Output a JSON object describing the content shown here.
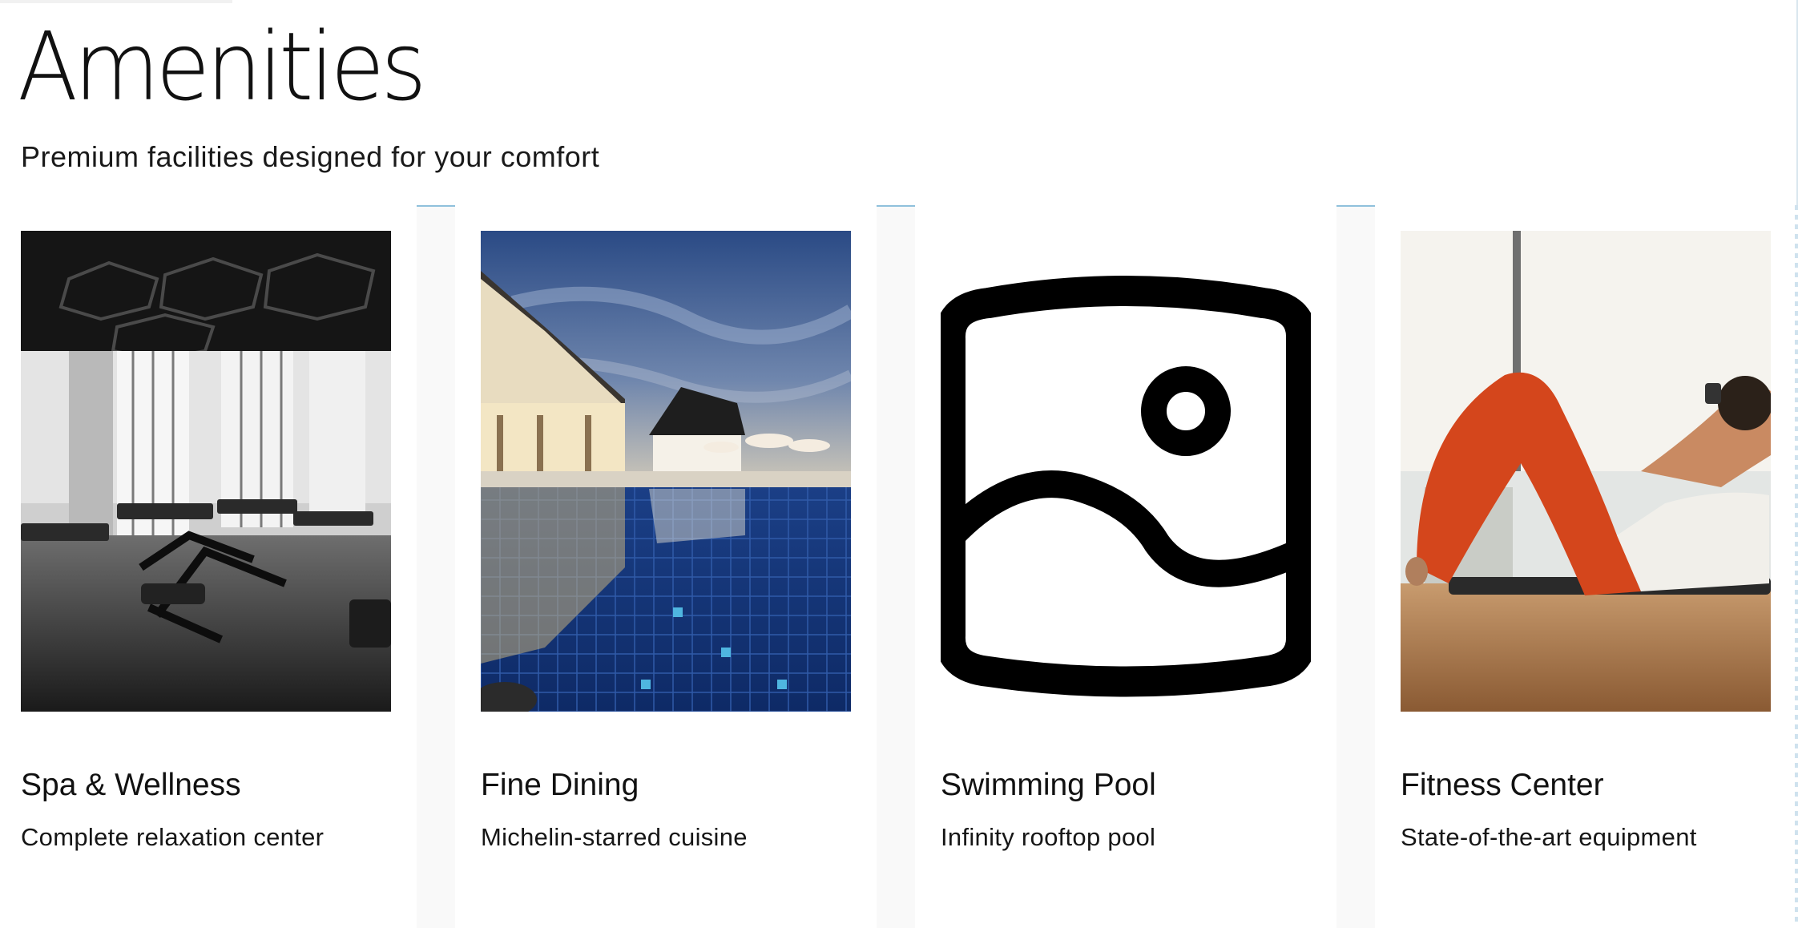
{
  "section": {
    "title": "Amenities",
    "subtitle": "Premium facilities designed for your comfort"
  },
  "amenities": [
    {
      "title": "Spa & Wellness",
      "description": "Complete relaxation center",
      "image": "gym-photo-grayscale"
    },
    {
      "title": "Fine Dining",
      "description": "Michelin-starred cuisine",
      "image": "poolside-restaurant-photo"
    },
    {
      "title": "Swimming Pool",
      "description": "Infinity rooftop pool",
      "image": "image-placeholder-icon"
    },
    {
      "title": "Fitness Center",
      "description": "State-of-the-art equipment",
      "image": "workout-photo"
    }
  ],
  "colors": {
    "background": "#ffffff",
    "text": "#111111",
    "gutter": "#f9f9f9",
    "accent_line": "#8fc0dc"
  }
}
